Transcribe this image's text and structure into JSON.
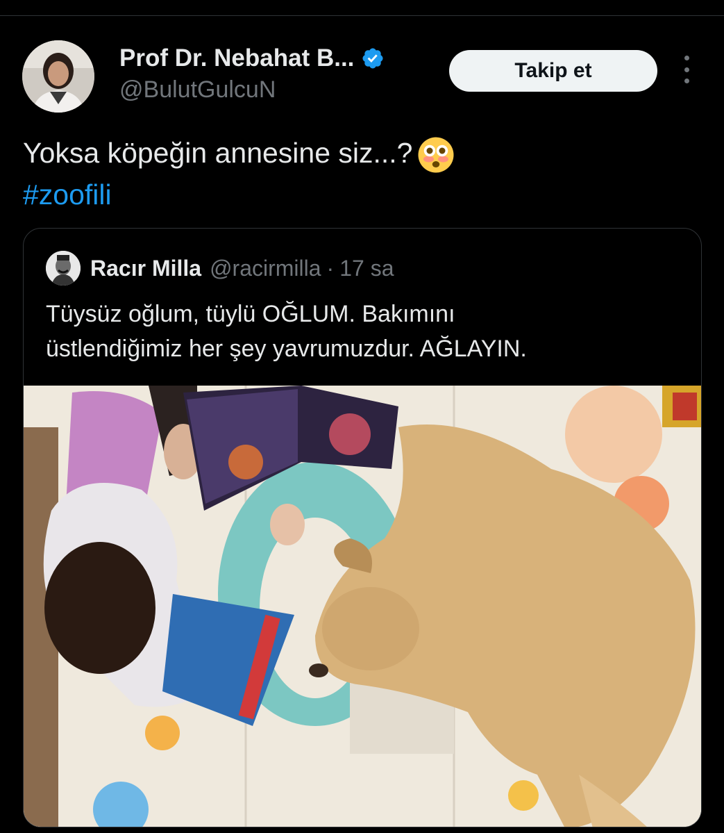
{
  "author": {
    "display_name": "Prof Dr. Nebahat B...",
    "handle": "@BulutGulcuN",
    "verified": true
  },
  "actions": {
    "follow_label": "Takip et"
  },
  "tweet": {
    "text": "Yoksa köpeğin annesine siz...?",
    "emoji": "flushed-face",
    "hashtag": "#zoofili"
  },
  "quoted": {
    "display_name": "Racır Milla",
    "handle": "@racirmilla",
    "separator": "·",
    "time": "17 sa",
    "text_line1": "Tüysüz oğlum, tüylü OĞLUM. Bakımını",
    "text_line2": "üstlendiğimiz her şey yavrumuzdur. AĞLAYIN.",
    "media": "photo-child-and-dog-on-play-mat"
  },
  "colors": {
    "background": "#000000",
    "text": "#e7e9ea",
    "muted": "#71767b",
    "link": "#1d9bf0",
    "border": "#2f3336",
    "verified": "#1d9bf0"
  }
}
